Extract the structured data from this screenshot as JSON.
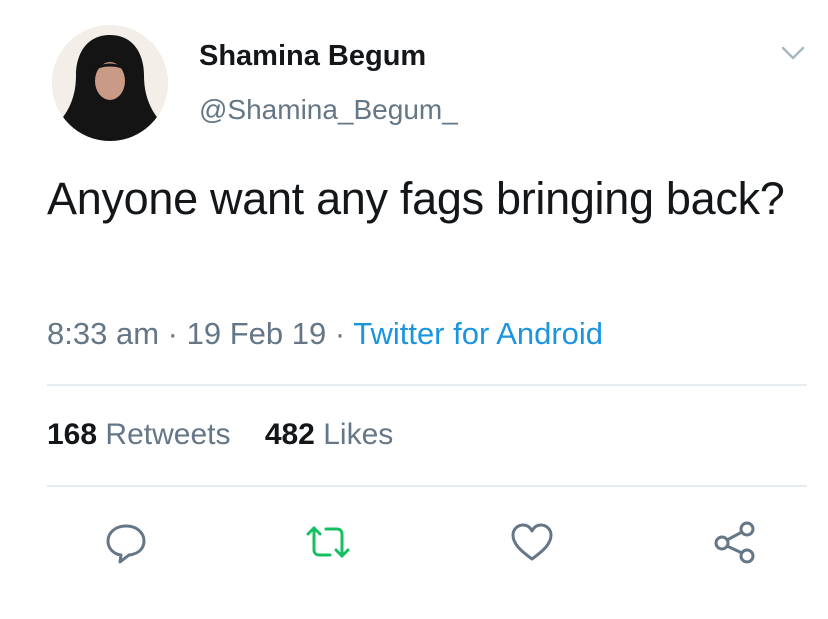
{
  "user": {
    "name": "Shamina Begum",
    "handle": "@Shamina_Begum_"
  },
  "tweet": {
    "text": "Anyone want any fags bringing back?",
    "time": "8:33 am",
    "date": "19 Feb 19",
    "separator": "·",
    "source": "Twitter for Android"
  },
  "stats": {
    "retweets_count": "168",
    "retweets_label": "Retweets",
    "likes_count": "482",
    "likes_label": "Likes"
  },
  "icons": {
    "menu": "chevron-down-icon",
    "reply": "reply-icon",
    "retweet": "retweet-icon",
    "like": "heart-icon",
    "share": "share-icon"
  },
  "colors": {
    "text": "#14171a",
    "secondary": "#657786",
    "link": "#1b95e0",
    "retweet_accent": "#17bf63",
    "divider": "#e6ecf0"
  }
}
